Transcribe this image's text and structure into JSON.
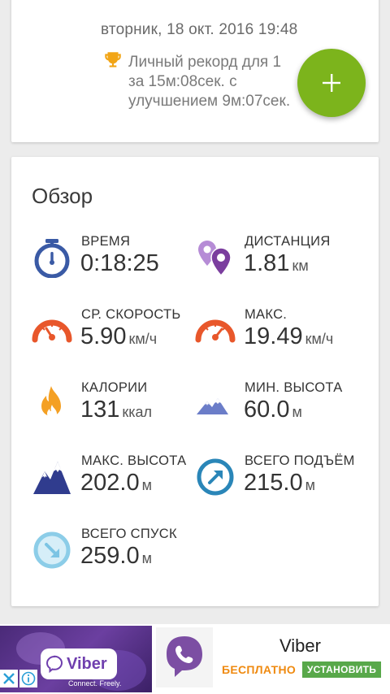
{
  "activity_card": {
    "date": "вторник, 18 окт. 2016 19:48",
    "record_line1": "Личный рекорд  для 1",
    "record_line2": "за 15м:08сек. с",
    "record_line3": "улучшением 9м:07сек."
  },
  "fab": {
    "icon": "plus-icon",
    "color": "#7cb41c"
  },
  "overview": {
    "title": "Обзор",
    "stats": [
      {
        "label": "ВРЕМЯ",
        "value": "0:18:25",
        "unit": "",
        "icon": "stopwatch-icon"
      },
      {
        "label": "ДИСТАНЦИЯ",
        "value": "1.81",
        "unit": "км",
        "icon": "map-pins-icon"
      },
      {
        "label": "СР. СКОРОСТЬ",
        "value": "5.90",
        "unit": "км/ч",
        "icon": "speedometer-icon"
      },
      {
        "label": "МАКС.",
        "value": "19.49",
        "unit": "км/ч",
        "icon": "speedometer-max-icon"
      },
      {
        "label": "КАЛОРИИ",
        "value": "131",
        "unit": "ккал",
        "icon": "flame-icon"
      },
      {
        "label": "МИН. ВЫСОТА",
        "value": "60.0",
        "unit": "м",
        "icon": "mountain-low-icon"
      },
      {
        "label": "МАКС. ВЫСОТА",
        "value": "202.0",
        "unit": "м",
        "icon": "mountain-high-icon"
      },
      {
        "label": "ВСЕГО ПОДЪЁМ",
        "value": "215.0",
        "unit": "м",
        "icon": "ascent-arrow-icon"
      },
      {
        "label": "ВСЕГО СПУСК",
        "value": "259.0",
        "unit": "м",
        "icon": "descent-arrow-icon"
      }
    ]
  },
  "ad": {
    "banner_logo": "Viber",
    "banner_tagline": "Connect. Freely.",
    "app_name": "Viber",
    "price": "БЕСПЛАТНО",
    "install_label": "УСТАНОВИТЬ"
  }
}
